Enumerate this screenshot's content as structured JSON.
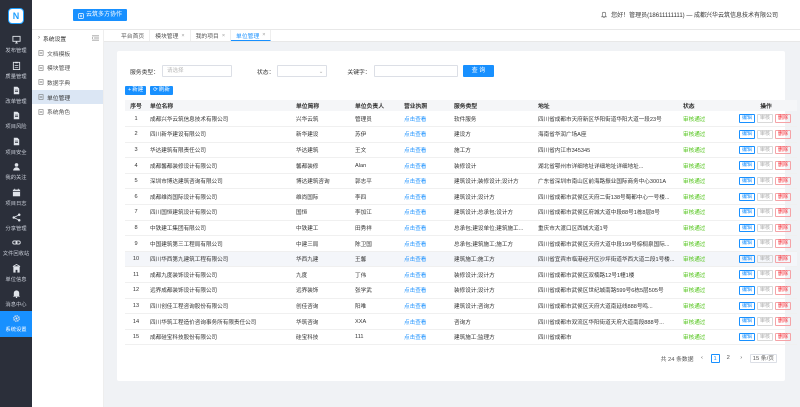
{
  "brand": {
    "logo": "N",
    "button_label": "云筑多方协作"
  },
  "header": {
    "user_text": "您好！管理员(18611111111) — 成都兴华云筑信息技术有限公司"
  },
  "sidebar": [
    {
      "label": "发布管理",
      "icon": "monitor-icon"
    },
    {
      "label": "质量管理",
      "icon": "clipboard-icon"
    },
    {
      "label": "改单管理",
      "icon": "document-icon"
    },
    {
      "label": "项目风险",
      "icon": "document-icon"
    },
    {
      "label": "项目安全",
      "icon": "document-icon"
    },
    {
      "label": "我的关注",
      "icon": "user-icon"
    },
    {
      "label": "项目日志",
      "icon": "calendar-icon"
    },
    {
      "label": "分享管理",
      "icon": "share-icon"
    },
    {
      "label": "文件回收站",
      "icon": "link-icon"
    },
    {
      "label": "单位信息",
      "icon": "building-icon"
    },
    {
      "label": "消息中心",
      "icon": "bell-icon"
    },
    {
      "label": "系统设置",
      "icon": "gear-icon",
      "active": true
    }
  ],
  "submenu": {
    "title": "系统设置",
    "items": [
      {
        "label": "文档模板",
        "active": false
      },
      {
        "label": "模块管理",
        "active": false
      },
      {
        "label": "数据字典",
        "active": false
      },
      {
        "label": "单位管理",
        "active": true
      },
      {
        "label": "系统角色",
        "active": false
      }
    ]
  },
  "tabs": [
    {
      "label": "平台首页",
      "closable": false,
      "active": false
    },
    {
      "label": "模块管理",
      "closable": true,
      "active": false
    },
    {
      "label": "我的项目",
      "closable": true,
      "active": false
    },
    {
      "label": "单位管理",
      "closable": true,
      "active": true
    }
  ],
  "filters": {
    "service_type_label": "服务类型：",
    "service_type_placeholder": "请选择",
    "status_label": "状态：",
    "status_value": "",
    "keyword_label": "关键字：",
    "keyword_value": "",
    "query_button": "查 询"
  },
  "toolbar": {
    "new_label": "新建",
    "refresh_label": "刷新"
  },
  "table": {
    "headers": [
      "序号",
      "单位名称",
      "单位简称",
      "单位负责人",
      "营业执照",
      "服务类型",
      "地址",
      "状态",
      "操作"
    ],
    "license_link": "点击查看",
    "status_text": "审核通过",
    "op_edit": "编辑",
    "op_audit": "审核",
    "op_delete": "删除",
    "rows": [
      {
        "no": "1",
        "name": "成都兴华云筑信息技术有限公司",
        "short": "兴华云筑",
        "head": "管理员",
        "type": "软件服务",
        "addr": "四川省成都市天府新区华阳街道华阳大道一段23号"
      },
      {
        "no": "2",
        "name": "四川新华建设有限公司",
        "short": "新华建设",
        "head": "苏伊",
        "type": "建设方",
        "addr": "海南省华润广场A座"
      },
      {
        "no": "3",
        "name": "华达建筑有限责任公司",
        "short": "华达建筑",
        "head": "王文",
        "type": "施工方",
        "addr": "四川省内江市345345"
      },
      {
        "no": "4",
        "name": "成都馨都装修设计有限公司",
        "short": "馨都装修",
        "head": "Alan",
        "type": "装修设计",
        "addr": "湖北省鄂州市详细地址详细地址详细地址..."
      },
      {
        "no": "5",
        "name": "深圳市博达建筑咨询有限公司",
        "short": "博达建筑咨询",
        "head": "郭志平",
        "type": "建筑设计;装修设计;设计方",
        "addr": "广东省深圳市南山区前海路振业国际商务中心3001A"
      },
      {
        "no": "6",
        "name": "成都维尚国际设计有限公司",
        "short": "维尚国际",
        "head": "李四",
        "type": "建筑设计;设计方",
        "addr": "四川省成都市武侯区天府二街138号蜀都中心一号楼..."
      },
      {
        "no": "7",
        "name": "四川国恒建筑设计有限公司",
        "short": "国恒",
        "head": "李加江",
        "type": "建筑设计;总承包;设计方",
        "addr": "四川省成都市武侯区府城大道中段88号1栋8层8号"
      },
      {
        "no": "8",
        "name": "中铁建工集团有限公司",
        "short": "中铁建工",
        "head": "田秀祥",
        "type": "总承包;建设单位;建筑施工...",
        "addr": "重庆市大渡口区西城大道1号"
      },
      {
        "no": "9",
        "name": "中国建筑第三工程局有限公司",
        "short": "中建三局",
        "head": "陈卫国",
        "type": "总承包;建筑施工;施工方",
        "addr": "四川省成都市武侯区天府大道中段199号棕榈泉国际..."
      },
      {
        "no": "10",
        "name": "四川华西第九建筑工程有限公司",
        "short": "华西九建",
        "head": "王馨",
        "type": "建筑施工;施工方",
        "addr": "四川省宜宾市临港经开区沙坪街道华西大道二段1号楼..."
      },
      {
        "no": "11",
        "name": "成都九度装饰设计有限公司",
        "short": "九度",
        "head": "丁伟",
        "type": "装修设计;设计方",
        "addr": "四川省成都市武侯区双楠路12号1幢1楼"
      },
      {
        "no": "12",
        "name": "远界成都装饰设计有限公司",
        "short": "远界装饰",
        "head": "张学武",
        "type": "装修设计;设计方",
        "addr": "四川省成都市武侯区世纪城南路599号6栋5层505号"
      },
      {
        "no": "13",
        "name": "四川创佳工程咨询股份有限公司",
        "short": "创佳咨询",
        "head": "阳唯",
        "type": "建筑设计;咨询方",
        "addr": "四川省成都市武侯区天府大道南延线888号鸣..."
      },
      {
        "no": "14",
        "name": "四川华筑工程造价咨询事务所有限责任公司",
        "short": "华筑咨询",
        "head": "XXA",
        "type": "咨询方",
        "addr": "四川省成都市双流区华阳街道天府大道南段888号..."
      },
      {
        "no": "15",
        "name": "成都硅宝科技股份有限公司",
        "short": "硅宝科技",
        "head": "111",
        "type": "建筑施工;监理方",
        "addr": "四川省成都市"
      }
    ]
  },
  "pager": {
    "total": "共 24 条数据",
    "prev": "‹",
    "pages": [
      "1",
      "2"
    ],
    "next": "›",
    "size": "15 条/页"
  }
}
